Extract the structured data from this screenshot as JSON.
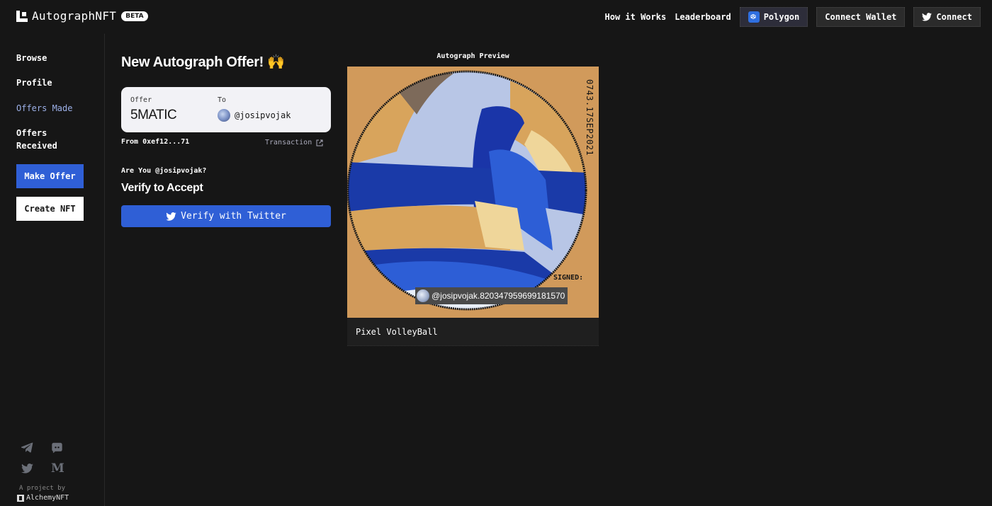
{
  "header": {
    "logo_text": "AutographNFT",
    "beta_badge": "BETA",
    "nav": {
      "how_it_works": "How it Works",
      "leaderboard": "Leaderboard",
      "network": "Polygon",
      "connect_wallet": "Connect Wallet",
      "connect_twitter": "Connect"
    }
  },
  "sidebar": {
    "items": [
      {
        "label": "Browse"
      },
      {
        "label": "Profile"
      },
      {
        "label": "Offers Made",
        "active": true
      },
      {
        "label": "Offers\nReceived"
      }
    ],
    "make_offer": "Make Offer",
    "create_nft": "Create NFT",
    "social_icons": [
      "telegram-icon",
      "discord-icon",
      "twitter-icon",
      "medium-icon"
    ],
    "project_by": "A project by",
    "alchemy": "AlchemyNFT"
  },
  "main": {
    "title": "New Autograph Offer! 🙌",
    "offer_card": {
      "offer_label": "Offer",
      "amount": "5MATIC",
      "to_label": "To",
      "to_handle": "@josipvojak"
    },
    "from": "From 0xef12...71",
    "transaction": "Transaction",
    "are_you": "Are You @josipvojak?",
    "verify_title": "Verify to Accept",
    "verify_button": "Verify with Twitter"
  },
  "preview": {
    "heading": "Autograph Preview",
    "date_stamp": "0743.17SEP2021",
    "signed_label": "SIGNED:",
    "signature": "@josipvojak.820347959699181570",
    "caption": "Pixel VolleyBall"
  },
  "colors": {
    "background": "#161616",
    "accent": "#2f5fd6",
    "active_nav": "#9cb0e8",
    "preview_bg": "#d19a5b"
  }
}
